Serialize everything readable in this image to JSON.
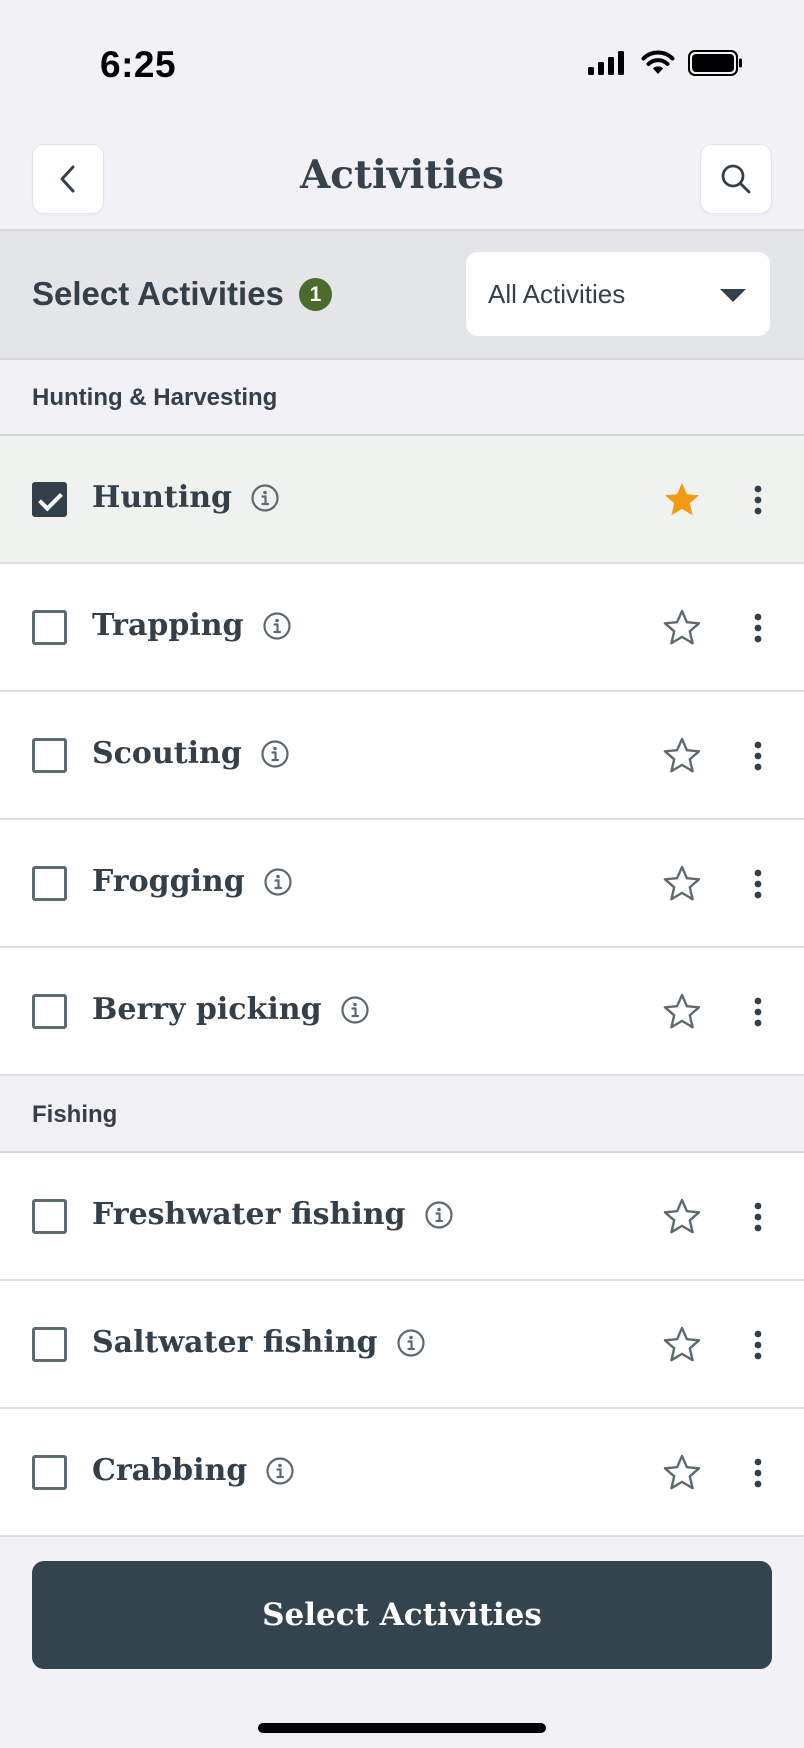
{
  "status_bar": {
    "time": "6:25"
  },
  "nav": {
    "title": "Activities",
    "back_icon": "chevron-left-icon",
    "search_icon": "search-icon"
  },
  "select_header": {
    "title": "Select Activities",
    "count": "1",
    "dropdown_value": "All Activities"
  },
  "sections": [
    {
      "title": "Hunting & Harvesting",
      "items": [
        {
          "label": "Hunting",
          "checked": true,
          "favorite": true
        },
        {
          "label": "Trapping",
          "checked": false,
          "favorite": false
        },
        {
          "label": "Scouting",
          "checked": false,
          "favorite": false
        },
        {
          "label": "Frogging",
          "checked": false,
          "favorite": false
        },
        {
          "label": "Berry picking",
          "checked": false,
          "favorite": false
        }
      ]
    },
    {
      "title": "Fishing",
      "items": [
        {
          "label": "Freshwater fishing",
          "checked": false,
          "favorite": false
        },
        {
          "label": "Saltwater fishing",
          "checked": false,
          "favorite": false
        },
        {
          "label": "Crabbing",
          "checked": false,
          "favorite": false
        }
      ]
    }
  ],
  "footer": {
    "button_label": "Select Activities"
  },
  "colors": {
    "accent_badge": "#4b6a2c",
    "star_active": "#f39a12",
    "primary_button": "#33444e",
    "text": "#33404a"
  }
}
